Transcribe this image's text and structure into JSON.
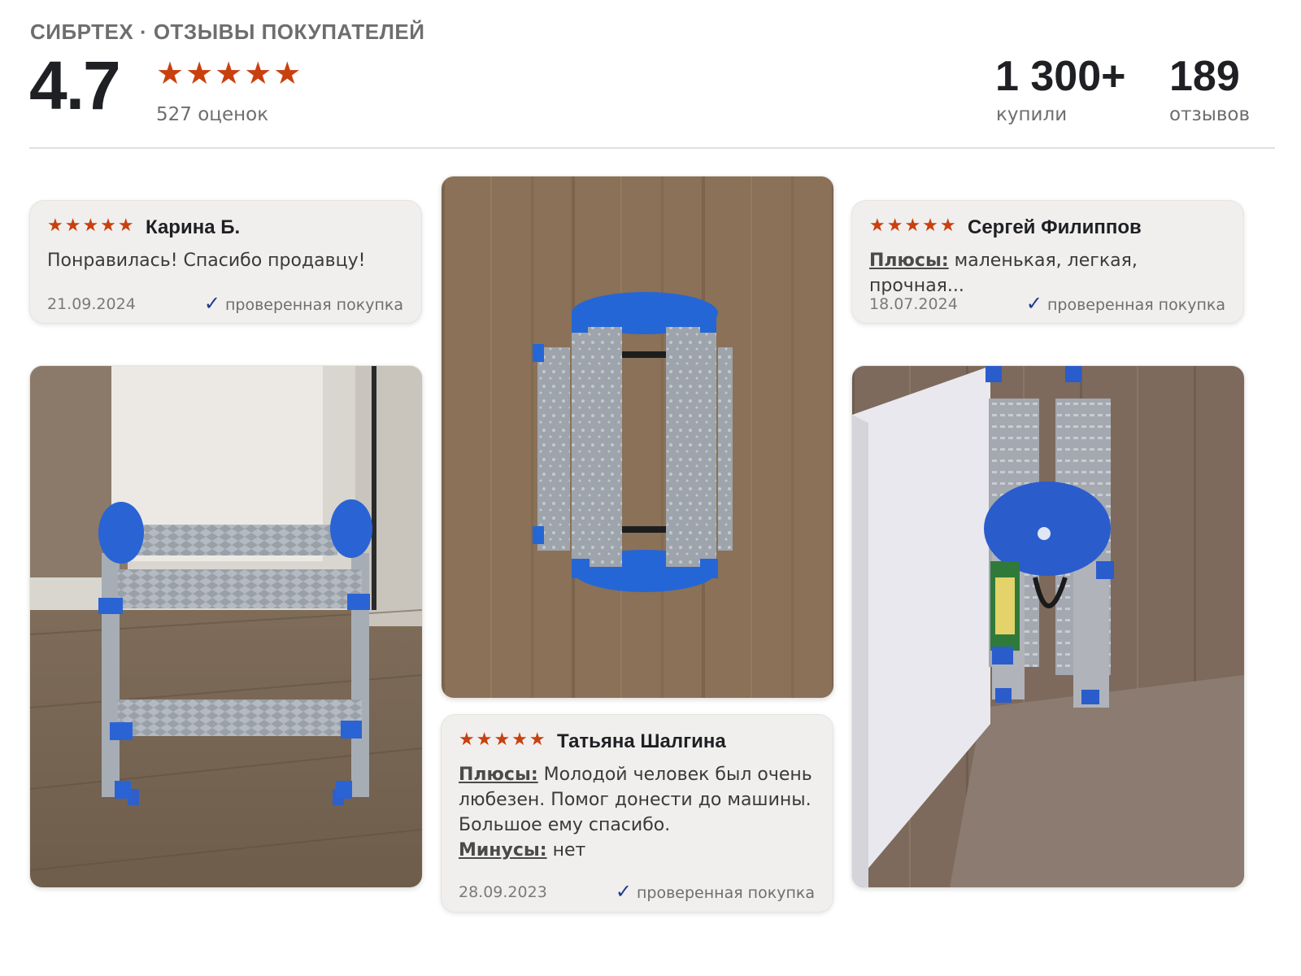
{
  "header": {
    "brand": "СИБРТЕХ · ОТЗЫВЫ ПОКУПАТЕЛЕЙ",
    "rating": "4.7",
    "stars": "★★★★★",
    "rating_count": "527 оценок",
    "stats": [
      {
        "value": "1 300+",
        "label": "купили"
      },
      {
        "value": "189",
        "label": "отзывов"
      }
    ]
  },
  "reviews": [
    {
      "stars": "★★★★★",
      "name": "Карина Б.",
      "text": "Понравилась! Спасибо продавцу!",
      "date": "21.09.2024",
      "verified": "проверенная покупка"
    },
    {
      "stars": "★★★★★",
      "name": "Сергей Филиппов",
      "pros_label": "Плюсы:",
      "pros": " маленькая, легкая, прочная...",
      "date": "18.07.2024",
      "verified": "проверенная покупка"
    },
    {
      "stars": "★★★★★",
      "name": "Татьяна Шалгина",
      "pros_label": "Плюсы:",
      "pros": " Молодой человек был очень любезен. Помог донести до машины. Большое ему спасибо.",
      "cons_label": "Минусы:",
      "cons": " нет",
      "date": "28.09.2023",
      "verified": "проверенная покупка"
    }
  ],
  "colors": {
    "star": "#c9400f",
    "check": "#1e3c8c",
    "card_bg": "#f0efed"
  }
}
